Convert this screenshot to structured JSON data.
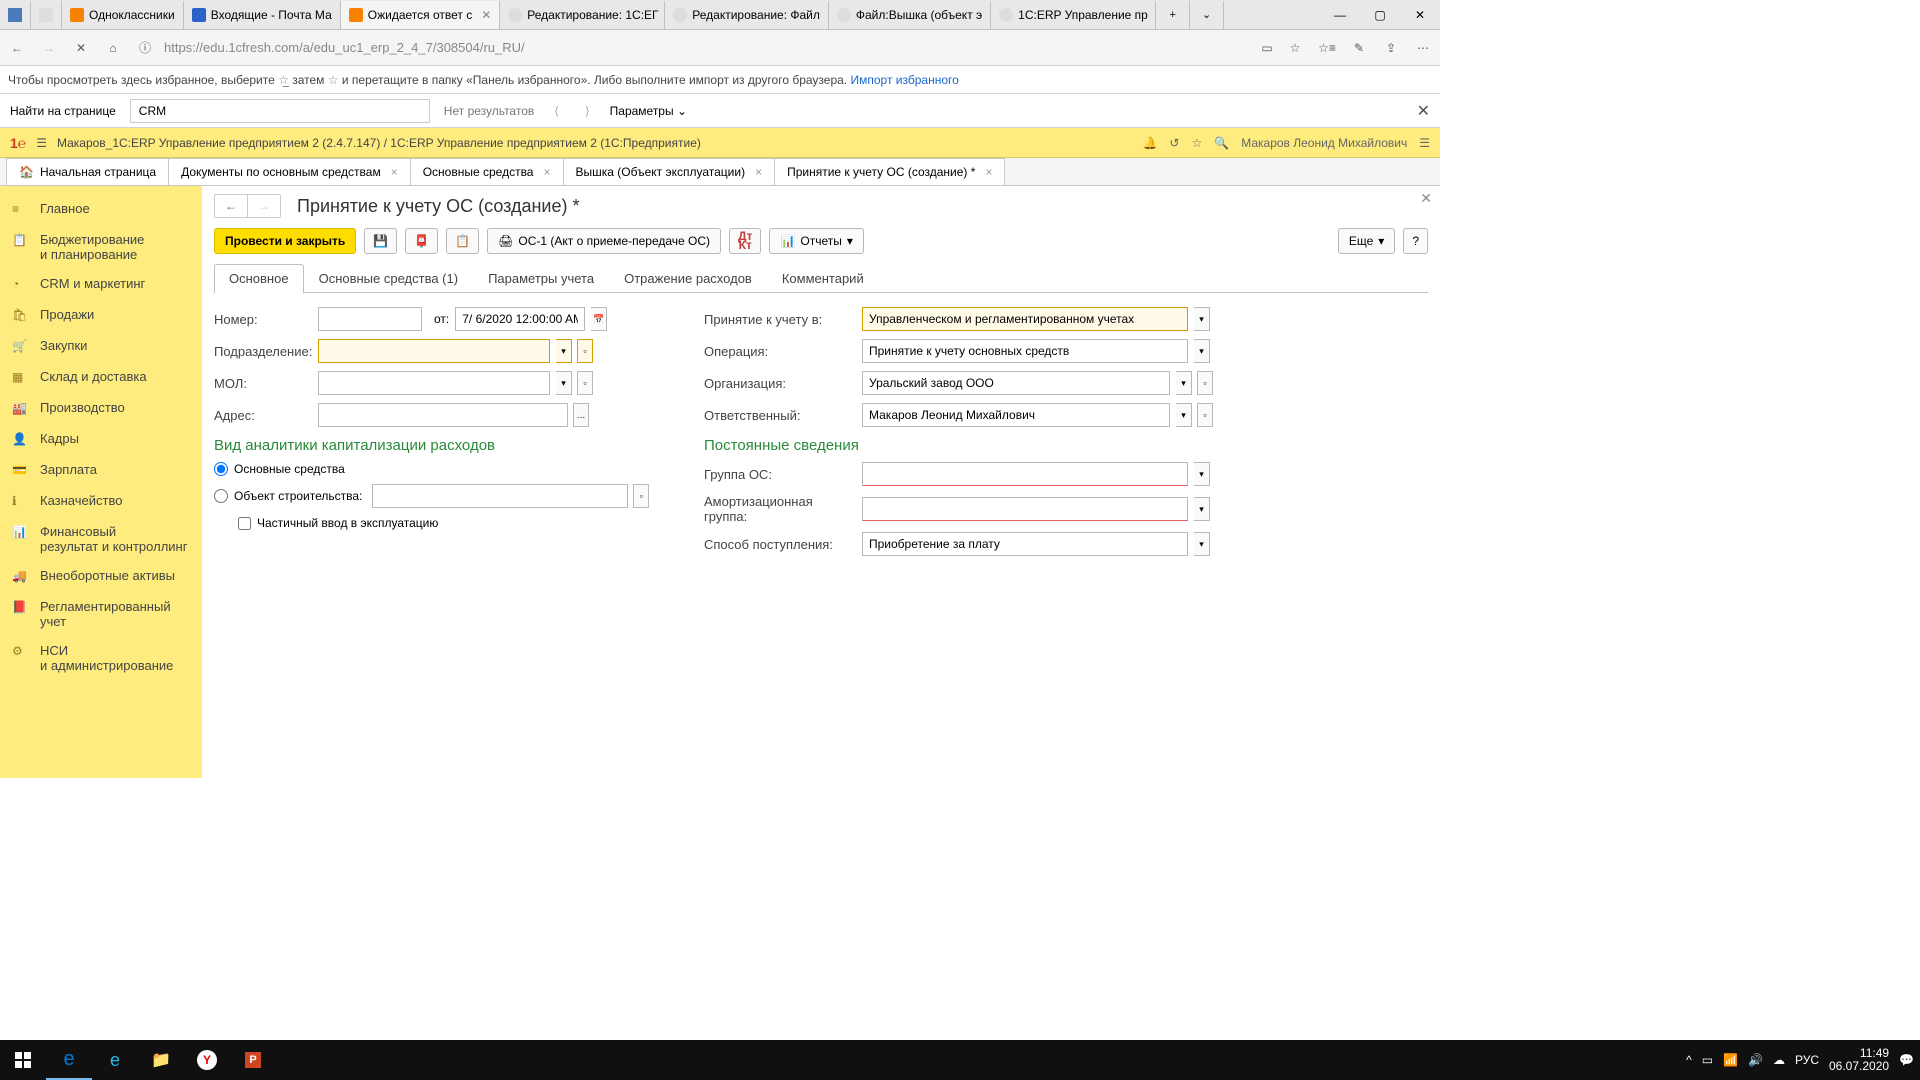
{
  "browser_tabs": [
    {
      "label": "Одноклассники",
      "ico": "ok"
    },
    {
      "label": "Входящие - Почта Ма",
      "ico": "mail"
    },
    {
      "label": "Ожидается ответ с",
      "ico": "1c",
      "active": true,
      "close": true
    },
    {
      "label": "Редактирование: 1С:ЕГ",
      "ico": "wiki"
    },
    {
      "label": "Редактирование: Файл",
      "ico": "wiki"
    },
    {
      "label": "Файл:Вышка (объект э",
      "ico": "wiki"
    },
    {
      "label": "1С:ERP Управление пр",
      "ico": "wiki"
    }
  ],
  "url": "https://edu.1cfresh.com/a/edu_uc1_erp_2_4_7/308504/ru_RU/",
  "fav_hint": {
    "t1": "Чтобы просмотреть здесь избранное, выберите ",
    "t2": " затем ",
    "t3": " и перетащите в папку «Панель избранного». Либо выполните импорт из другого браузера. ",
    "link": "Импорт избранного"
  },
  "find": {
    "label": "Найти на странице",
    "value": "CRM",
    "none": "Нет результатов",
    "params": "Параметры"
  },
  "app_title": "Макаров_1С:ERP Управление предприятием 2 (2.4.7.147) / 1С:ERP Управление предприятием 2   (1С:Предприятие)",
  "user": "Макаров Леонид Михайлович",
  "app_tabs": [
    {
      "label": "Начальная страница",
      "home": true
    },
    {
      "label": "Документы по основным средствам",
      "x": true
    },
    {
      "label": "Основные средства",
      "x": true
    },
    {
      "label": "Вышка (Объект эксплуатации)",
      "x": true
    },
    {
      "label": "Принятие к учету ОС (создание) *",
      "x": true,
      "active": true
    }
  ],
  "sidenav": [
    {
      "label": "Главное",
      "ico": "menu"
    },
    {
      "label": "Бюджетирование\nи планирование",
      "ico": "plan"
    },
    {
      "label": "CRM и маркетинг",
      "ico": "pie"
    },
    {
      "label": "Продажи",
      "ico": "bag"
    },
    {
      "label": "Закупки",
      "ico": "cart"
    },
    {
      "label": "Склад и доставка",
      "ico": "boxes"
    },
    {
      "label": "Производство",
      "ico": "factory"
    },
    {
      "label": "Кадры",
      "ico": "person"
    },
    {
      "label": "Зарплата",
      "ico": "card"
    },
    {
      "label": "Казначейство",
      "ico": "info"
    },
    {
      "label": "Финансовый\nрезультат и контроллинг",
      "ico": "chart"
    },
    {
      "label": "Внеоборотные активы",
      "ico": "truck"
    },
    {
      "label": "Регламентированный\nучет",
      "ico": "book"
    },
    {
      "label": "НСИ\nи администрирование",
      "ico": "gear"
    }
  ],
  "page": {
    "title": "Принятие к учету ОС (создание) *",
    "toolbar": {
      "process": "Провести и закрыть",
      "os1": "ОС-1 (Акт о приеме-передаче ОС)",
      "reports": "Отчеты",
      "more": "Еще"
    },
    "tabs": [
      "Основное",
      "Основные средства (1)",
      "Параметры учета",
      "Отражение расходов",
      "Комментарий"
    ],
    "active_tab": 0,
    "left": {
      "number": "Номер:",
      "ot": "от:",
      "date": "7/ 6/2020 12:00:00 AM",
      "dept": "Подразделение:",
      "mol": "МОЛ:",
      "addr": "Адрес:",
      "analytics": "Вид аналитики капитализации расходов",
      "r1": "Основные средства",
      "r2": "Объект строительства:",
      "chk": "Частичный ввод в эксплуатацию"
    },
    "right": {
      "accept": "Принятие к учету в:",
      "accept_v": "Управленческом и регламентированном учетах",
      "op": "Операция:",
      "op_v": "Принятие к учету основных средств",
      "org": "Организация:",
      "org_v": "Уральский завод ООО",
      "resp": "Ответственный:",
      "resp_v": "Макаров Леонид Михайлович",
      "const": "Постоянные сведения",
      "group": "Группа ОС:",
      "amort": "Амортизационная группа:",
      "way": "Способ поступления:",
      "way_v": "Приобретение за плату"
    }
  },
  "taskbar": {
    "time": "11:49",
    "date": "06.07.2020",
    "lang": "РУС"
  }
}
